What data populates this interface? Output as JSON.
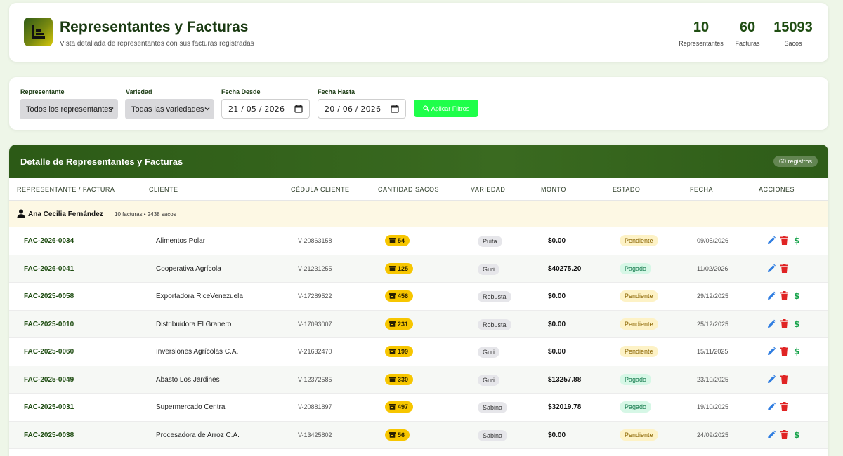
{
  "header": {
    "title": "Representantes y Facturas",
    "subtitle": "Vista detallada de representantes con sus facturas registradas",
    "stats": [
      {
        "value": "10",
        "label": "Representantes"
      },
      {
        "value": "60",
        "label": "Facturas"
      },
      {
        "value": "15093",
        "label": "Sacos"
      }
    ]
  },
  "filters": {
    "representante_label": "Representante",
    "representante_value": "Todos los representantes",
    "variedad_label": "Variedad",
    "variedad_value": "Todas las variedades",
    "fecha_desde_label": "Fecha Desde",
    "fecha_desde_value": "21 / 05 / 2026",
    "fecha_hasta_label": "Fecha Hasta",
    "fecha_hasta_value": "20 / 06 / 2026",
    "apply_label": "Aplicar Filtros"
  },
  "table": {
    "title": "Detalle de Representantes y Facturas",
    "records_badge": "60 registros",
    "columns": [
      "REPRESENTANTE / FACTURA",
      "CLIENTE",
      "CÉDULA CLIENTE",
      "CANTIDAD SACOS",
      "VARIEDAD",
      "MONTO",
      "ESTADO",
      "FECHA",
      "ACCIONES"
    ],
    "group": {
      "name": "Ana Cecilia Fernández",
      "meta": "10 facturas • 2438 sacos"
    },
    "rows": [
      {
        "factura": "FAC-2026-0034",
        "cliente": "Alimentos Polar",
        "cedula": "V-20863158",
        "sacos": "54",
        "variedad": "Puita",
        "monto": "$0.00",
        "estado": "Pendiente",
        "fecha": "09/05/2026"
      },
      {
        "factura": "FAC-2026-0041",
        "cliente": "Cooperativa Agrícola",
        "cedula": "V-21231255",
        "sacos": "125",
        "variedad": "Guri",
        "monto": "$40275.20",
        "estado": "Pagado",
        "fecha": "11/02/2026"
      },
      {
        "factura": "FAC-2025-0058",
        "cliente": "Exportadora RiceVenezuela",
        "cedula": "V-17289522",
        "sacos": "456",
        "variedad": "Robusta",
        "monto": "$0.00",
        "estado": "Pendiente",
        "fecha": "29/12/2025"
      },
      {
        "factura": "FAC-2025-0010",
        "cliente": "Distribuidora El Granero",
        "cedula": "V-17093007",
        "sacos": "231",
        "variedad": "Robusta",
        "monto": "$0.00",
        "estado": "Pendiente",
        "fecha": "25/12/2025"
      },
      {
        "factura": "FAC-2025-0060",
        "cliente": "Inversiones Agrícolas C.A.",
        "cedula": "V-21632470",
        "sacos": "199",
        "variedad": "Guri",
        "monto": "$0.00",
        "estado": "Pendiente",
        "fecha": "15/11/2025"
      },
      {
        "factura": "FAC-2025-0049",
        "cliente": "Abasto Los Jardines",
        "cedula": "V-12372585",
        "sacos": "330",
        "variedad": "Guri",
        "monto": "$13257.88",
        "estado": "Pagado",
        "fecha": "23/10/2025"
      },
      {
        "factura": "FAC-2025-0031",
        "cliente": "Supermercado Central",
        "cedula": "V-20881897",
        "sacos": "497",
        "variedad": "Sabina",
        "monto": "$32019.78",
        "estado": "Pagado",
        "fecha": "19/10/2025"
      },
      {
        "factura": "FAC-2025-0038",
        "cliente": "Procesadora de Arroz C.A.",
        "cedula": "V-13425802",
        "sacos": "56",
        "variedad": "Sabina",
        "monto": "$0.00",
        "estado": "Pendiente",
        "fecha": "24/09/2025"
      }
    ]
  },
  "icons": {
    "logo": "bar-chart-icon",
    "select": "chevron-down-icon",
    "date": "calendar-icon",
    "apply": "search-icon",
    "group": "person-icon",
    "sacos": "box-icon",
    "edit": "pencil-icon",
    "delete": "trash-icon",
    "pay": "dollar-icon"
  },
  "colors": {
    "primary": "#2c5a16",
    "accent_button": "#1eff4a",
    "sacos_badge": "#f7c600",
    "edit": "#2f7de1",
    "delete": "#e02424",
    "pay": "#16a34a"
  }
}
